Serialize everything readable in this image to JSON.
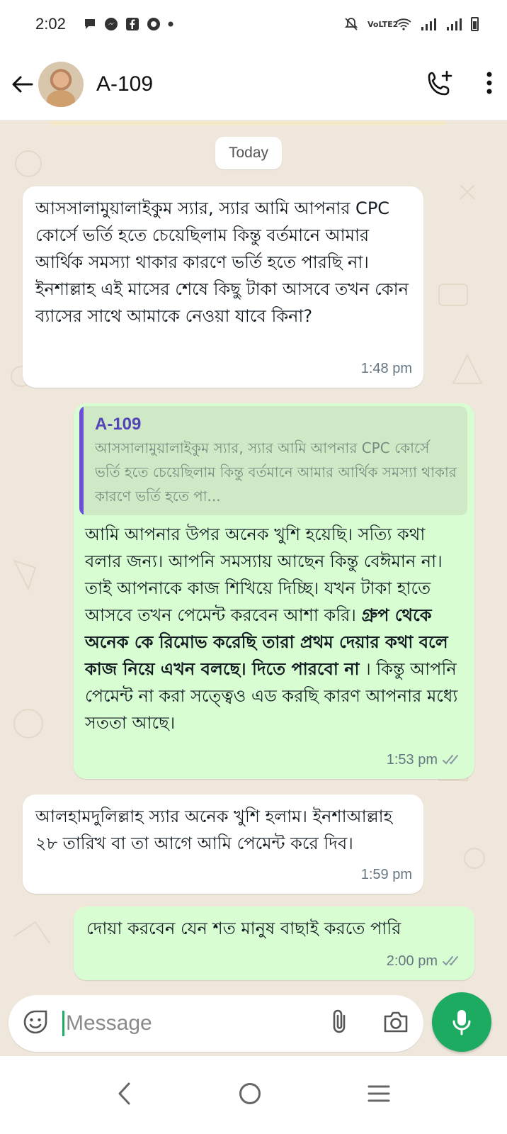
{
  "status_bar": {
    "time": "2:02",
    "network_label": "VoLTE2"
  },
  "header": {
    "contact_name": "A-109"
  },
  "chat": {
    "date_label": "Today",
    "messages": [
      {
        "direction": "incoming",
        "text": "আসসালামুয়ালাইকুম স্যার, স্যার আমি আপনার CPC কোর্সে ভর্তি হতে চেয়েছিলাম কিন্তু বর্তমানে আমার আর্থিক সমস্যা থাকার কারণে ভর্তি হতে পারছি না। ইনশাল্লাহ এই মাসের শেষে কিছু টাকা আসবে তখন কোন ব্যাসের সাথে আমাকে নেওয়া যাবে কিনা?",
        "time": "1:48 pm"
      },
      {
        "direction": "outgoing",
        "quote_name": "A-109",
        "quote_text": "আসসালামুয়ালাইকুম স্যার, স্যার আমি আপনার CPC কোর্সে ভর্তি হতে চেয়েছিলাম কিন্তু বর্তমানে আমার আর্থিক সমস্যা থাকার কারণে ভর্তি হতে পা...",
        "text_part1": "আমি আপনার উপর অনেক খুশি হয়েছি। সত্যি কথা বলার জন্য। আপনি সমস্যায় আছেন কিন্তু বেঈমান না। তাই আপনাকে কাজ শিখিয়ে দিচ্ছি। যখন টাকা হাতে আসবে তখন পেমেন্ট করবেন আশা করি। ",
        "text_bold": "গ্রুপ থেকে অনেক কে রিমোভ করেছি তারা প্রথম দেয়ার কথা বলে কাজ নিয়ে এখন বলছে। দিতে পারবো না",
        "text_part2": " । কিন্তু আপনি পেমেন্ট না করা সত্ত্বেও এড করছি কারণ আপনার মধ্যে সততা আছে।",
        "time": "1:53 pm",
        "status": "read"
      },
      {
        "direction": "incoming",
        "text": "আলহামদুলিল্লাহ স্যার অনেক খুশি হলাম। ইনশাআল্লাহ ২৮ তারিখ বা তা আগে আমি পেমেন্ট করে দিব।",
        "time": "1:59 pm"
      },
      {
        "direction": "outgoing",
        "text": "দোয়া করবেন যেন শত মানুষ বাছাই করতে পারি",
        "time": "2:00 pm",
        "status": "read"
      }
    ]
  },
  "composer": {
    "placeholder": "Message"
  },
  "icons": {
    "back": "arrow-left-icon",
    "call": "add-call-icon",
    "menu": "more-vert-icon",
    "emoji": "emoji-icon",
    "attach": "paperclip-icon",
    "camera": "camera-icon",
    "mic": "microphone-icon"
  },
  "colors": {
    "accent": "#1daa61",
    "outgoing_bubble": "#d9fdd3",
    "quote_bar": "#6a4ed6"
  }
}
